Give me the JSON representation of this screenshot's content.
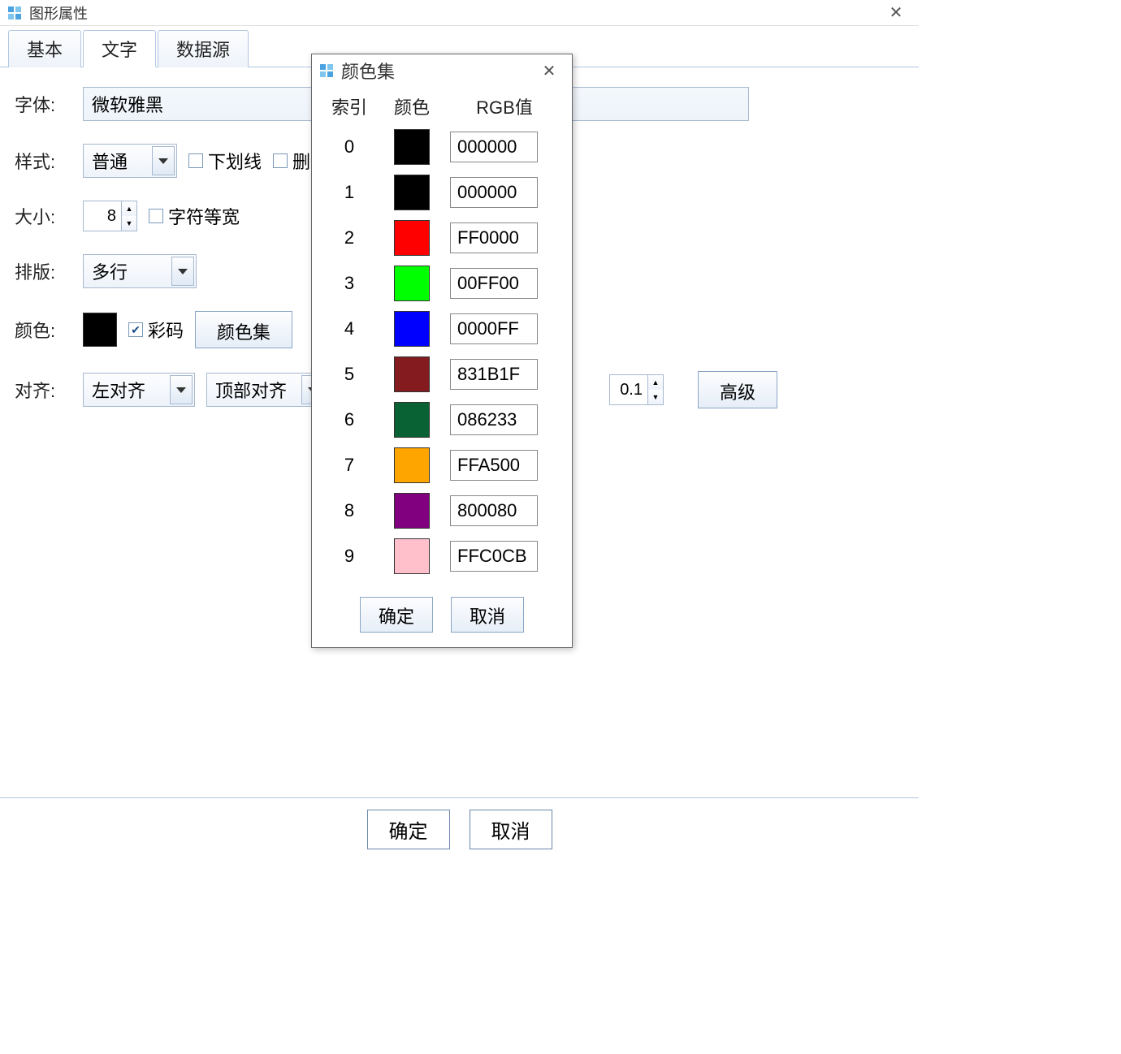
{
  "window": {
    "title": "图形属性"
  },
  "tabs": {
    "basic": "基本",
    "text": "文字",
    "datasource": "数据源"
  },
  "form": {
    "font_label": "字体:",
    "font_value": "微软雅黑",
    "style_label": "样式:",
    "style_value": "普通",
    "underline_label": "下划线",
    "strike_label": "删",
    "size_label": "大小:",
    "size_value": "8",
    "monospace_label": "字符等宽",
    "typeset_label": "排版:",
    "typeset_value": "多行",
    "color_label": "颜色:",
    "colorcode_label": "彩码",
    "colorset_btn": "颜色集",
    "align_label": "对齐:",
    "halign_value": "左对齐",
    "valign_value": "顶部对齐",
    "number_value": "0.1",
    "advanced_btn": "高级"
  },
  "footer": {
    "ok": "确定",
    "cancel": "取消"
  },
  "modal": {
    "title": "颜色集",
    "hdr_index": "索引",
    "hdr_color": "颜色",
    "hdr_rgb": "RGB值",
    "rows": [
      {
        "idx": "0",
        "color": "#000000",
        "rgb": "000000"
      },
      {
        "idx": "1",
        "color": "#000000",
        "rgb": "000000"
      },
      {
        "idx": "2",
        "color": "#FF0000",
        "rgb": "FF0000"
      },
      {
        "idx": "3",
        "color": "#00FF00",
        "rgb": "00FF00"
      },
      {
        "idx": "4",
        "color": "#0000FF",
        "rgb": "0000FF"
      },
      {
        "idx": "5",
        "color": "#831B1F",
        "rgb": "831B1F"
      },
      {
        "idx": "6",
        "color": "#086233",
        "rgb": "086233"
      },
      {
        "idx": "7",
        "color": "#FFA500",
        "rgb": "FFA500"
      },
      {
        "idx": "8",
        "color": "#800080",
        "rgb": "800080"
      },
      {
        "idx": "9",
        "color": "#FFC0CB",
        "rgb": "FFC0CB"
      }
    ],
    "ok": "确定",
    "cancel": "取消"
  }
}
